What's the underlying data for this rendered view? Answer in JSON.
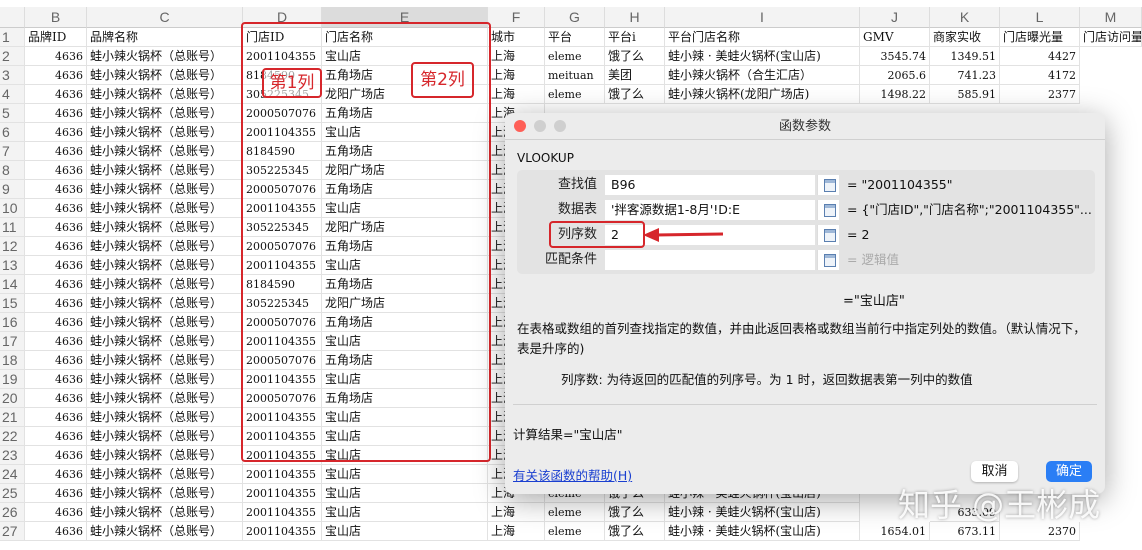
{
  "columns": [
    "B",
    "C",
    "D",
    "E",
    "F",
    "G",
    "H",
    "I",
    "J",
    "K",
    "L",
    "M"
  ],
  "headers": [
    "品牌ID",
    "品牌名称",
    "门店ID",
    "门店名称",
    "城市",
    "平台",
    "平台i",
    "平台门店名称",
    "GMV",
    "商家实收",
    "门店曝光量",
    "门店访问量"
  ],
  "brand_id": "4636",
  "brand_name": "蛙小辣火锅杯（总账号）",
  "city": "上海",
  "rows": [
    {
      "n": "2",
      "d": "2001104355",
      "e": "宝山店",
      "g": "eleme",
      "h": "饿了么",
      "i": "蛙小辣 · 美蛙火锅杯(宝山店)",
      "j": "3545.74",
      "k": "1349.51",
      "l": "4427"
    },
    {
      "n": "3",
      "d": "8184590",
      "e": "五角场店",
      "g": "meituan",
      "h": "美团",
      "i": "蛙小辣火锅杯（合生汇店）",
      "j": "2065.6",
      "k": "741.23",
      "l": "4172"
    },
    {
      "n": "4",
      "d": "305225345",
      "e": "龙阳广场店",
      "g": "eleme",
      "h": "饿了么",
      "i": "蛙小辣火锅杯(龙阳广场店)",
      "j": "1498.22",
      "k": "585.91",
      "l": "2377"
    },
    {
      "n": "5",
      "d": "2000507076",
      "e": "五角场店"
    },
    {
      "n": "6",
      "d": "2001104355",
      "e": "宝山店"
    },
    {
      "n": "7",
      "d": "8184590",
      "e": "五角场店"
    },
    {
      "n": "8",
      "d": "305225345",
      "e": "龙阳广场店"
    },
    {
      "n": "9",
      "d": "2000507076",
      "e": "五角场店"
    },
    {
      "n": "10",
      "d": "2001104355",
      "e": "宝山店"
    },
    {
      "n": "11",
      "d": "305225345",
      "e": "龙阳广场店"
    },
    {
      "n": "12",
      "d": "2000507076",
      "e": "五角场店"
    },
    {
      "n": "13",
      "d": "2001104355",
      "e": "宝山店"
    },
    {
      "n": "14",
      "d": "8184590",
      "e": "五角场店"
    },
    {
      "n": "15",
      "d": "305225345",
      "e": "龙阳广场店"
    },
    {
      "n": "16",
      "d": "2000507076",
      "e": "五角场店"
    },
    {
      "n": "17",
      "d": "2001104355",
      "e": "宝山店"
    },
    {
      "n": "18",
      "d": "2000507076",
      "e": "五角场店"
    },
    {
      "n": "19",
      "d": "2001104355",
      "e": "宝山店"
    },
    {
      "n": "20",
      "d": "2000507076",
      "e": "五角场店"
    },
    {
      "n": "21",
      "d": "2001104355",
      "e": "宝山店"
    },
    {
      "n": "22",
      "d": "2001104355",
      "e": "宝山店"
    },
    {
      "n": "23",
      "d": "2001104355",
      "e": "宝山店"
    },
    {
      "n": "24",
      "d": "2001104355",
      "e": "宝山店"
    },
    {
      "n": "25",
      "d": "2001104355",
      "e": "宝山店",
      "g": "eleme",
      "h": "饿了么",
      "i": "蛙小辣 · 美蛙火锅杯(宝山店)"
    },
    {
      "n": "26",
      "d": "2001104355",
      "e": "宝山店",
      "g": "eleme",
      "h": "饿了么",
      "i": "蛙小辣 · 美蛙火锅杯(宝山店)",
      "k": "633.09"
    },
    {
      "n": "27",
      "d": "2001104355",
      "e": "宝山店",
      "g": "eleme",
      "h": "饿了么",
      "i": "蛙小辣 · 美蛙火锅杯(宝山店)",
      "j": "1654.01",
      "k": "673.11",
      "l": "2370"
    }
  ],
  "annotations": {
    "col1": "第1列",
    "col2": "第2列"
  },
  "dialog": {
    "title": "函数参数",
    "function": "VLOOKUP",
    "args": [
      {
        "label": "查找值",
        "value": "B96",
        "result": "= \"2001104355\""
      },
      {
        "label": "数据表",
        "value": "'拌客源数据1-8月'!D:E",
        "result": "= {\"门店ID\",\"门店名称\";\"2001104355\"..."
      },
      {
        "label": "列序数",
        "value": "2",
        "result": "= 2"
      },
      {
        "label": "匹配条件",
        "value": "",
        "result": "= 逻辑值"
      }
    ],
    "formula_result": "=\"宝山店\"",
    "description": "在表格或数组的首列查找指定的数值，并由此返回表格或数组当前行中指定列处的数值。（默认情况下，表是升序的)",
    "arg_help": "列序数: 为待返回的匹配值的列序号。为 1 时，返回数据表第一列中的数值",
    "calc_result": "计算结果=\"宝山店\"",
    "help_link": "有关该函数的帮助(H)",
    "cancel": "取消",
    "ok": "确定"
  },
  "watermark": "知乎 @王彬成"
}
